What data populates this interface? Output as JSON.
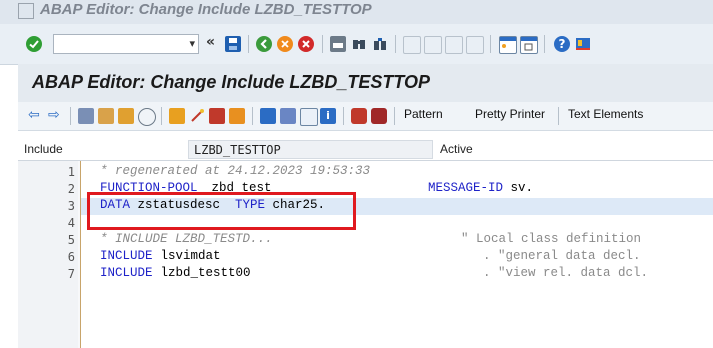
{
  "window": {
    "title": "ABAP Editor: Change Include LZBD_TESTTOP"
  },
  "system_toolbar": {
    "command_field": {
      "value": "",
      "placeholder": ""
    },
    "icons": [
      "enter-icon",
      "save-icon",
      "back-icon",
      "exit-icon",
      "cancel-icon",
      "print-icon",
      "find-icon",
      "find-next-icon",
      "first-page-icon",
      "previous-page-icon",
      "next-page-icon",
      "last-page-icon",
      "new-session-icon",
      "shortcut-icon",
      "help-icon",
      "customize-layout-icon"
    ],
    "colors": {
      "enter": "#2f9e34",
      "save": "#1f5fb0",
      "back": "#3b9b3c",
      "exit": "#f08a1c",
      "cancel": "#d22a2a",
      "help": "#2b6cc4"
    }
  },
  "screen_title": "ABAP Editor: Change Include LZBD_TESTTOP",
  "app_toolbar": {
    "buttons": {
      "pattern": "Pattern",
      "pretty_printer": "Pretty Printer",
      "text_elements": "Text Elements"
    }
  },
  "include_row": {
    "label": "Include",
    "value": "LZBD_TESTTOP",
    "status": "Active"
  },
  "editor": {
    "lines": [
      {
        "num": "1",
        "comment": "* regenerated at 24.12.2023 19:53:33"
      },
      {
        "num": "2",
        "kw1": "FUNCTION-POOL",
        "rest": " zbd_test",
        "kw2": "MESSAGE-ID",
        "rest2": " sv."
      },
      {
        "num": "3",
        "kw1": "DATA",
        "rest": " zstatusdesc ",
        "kw2": "TYPE",
        "rest2": " char25."
      },
      {
        "num": "4"
      },
      {
        "num": "5",
        "comment": "* INCLUDE LZBD_TESTD...",
        "trail": "\" Local class definition"
      },
      {
        "num": "6",
        "kw1": "INCLUDE",
        "rest": " lsvimdat",
        "trail": ". \"general data decl."
      },
      {
        "num": "7",
        "kw1": "INCLUDE",
        "rest": " lzbd_testt00",
        "trail": ". \"view rel. data dcl."
      }
    ],
    "highlight_line": 3,
    "highlight_color": "#e0191f"
  }
}
